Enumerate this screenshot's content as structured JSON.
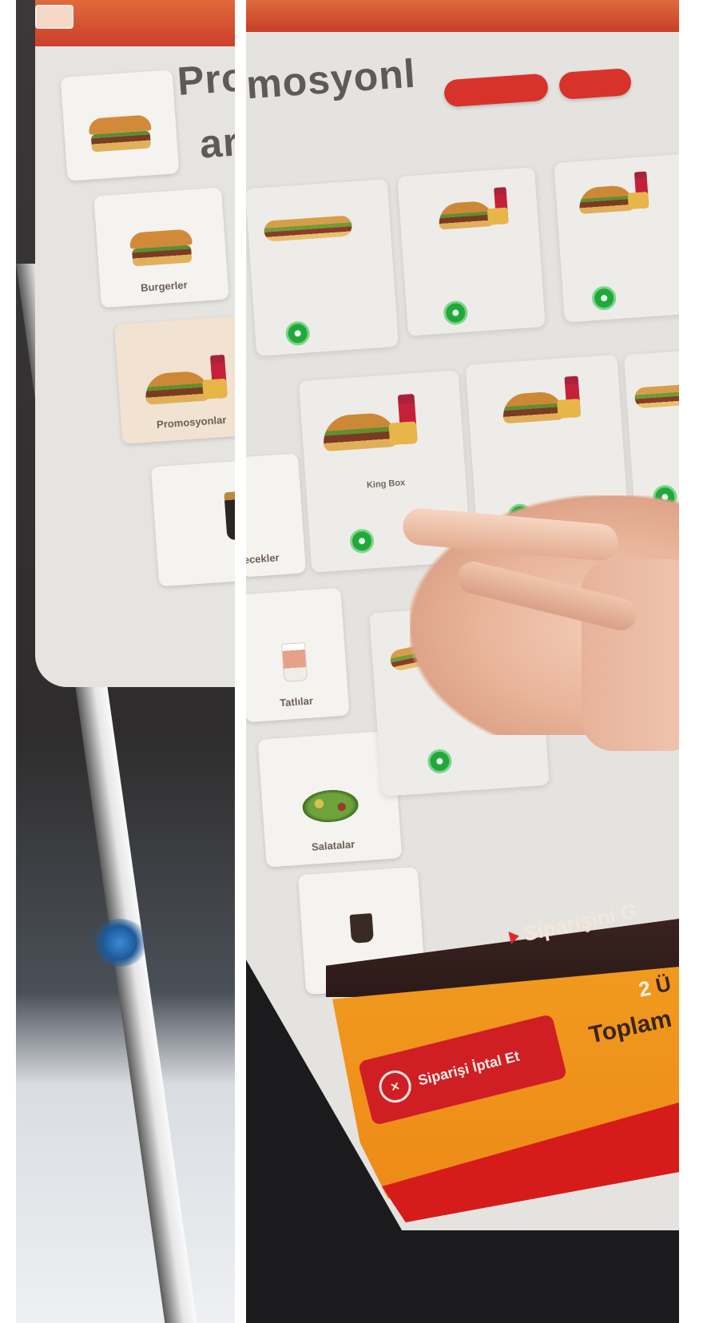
{
  "header": {
    "title_part1": "Pro",
    "title_part2": "mosyonl",
    "title_line2": "ar",
    "pill_left": "",
    "pill_right": ""
  },
  "sidebar": {
    "items": [
      {
        "label": "",
        "icon": "burger-icon"
      },
      {
        "label": "Burgerler",
        "icon": "burger-icon"
      },
      {
        "label": "Promosyonlar",
        "icon": "combo-meal-icon",
        "active": true
      },
      {
        "label": "İçecekler",
        "icon": "drink-icon"
      },
      {
        "label": "Tatlılar",
        "icon": "dessert-cup-icon"
      },
      {
        "label": "Salatalar",
        "icon": "salad-icon"
      },
      {
        "label": "",
        "icon": "coffee-icon"
      }
    ]
  },
  "products": [
    {
      "name": "",
      "price": "",
      "icon": "sub-sandwich-icon"
    },
    {
      "name": "",
      "price": "",
      "icon": "combo-meal-icon"
    },
    {
      "name": "",
      "price": "",
      "icon": "sandwich-icon"
    },
    {
      "name": "King Box",
      "price": "",
      "icon": "combo-meal-icon"
    },
    {
      "name": "",
      "price": "",
      "icon": "sandwich-combo-icon"
    },
    {
      "name": "",
      "price": "",
      "icon": "sandwich-icon"
    },
    {
      "name": "",
      "price": "",
      "icon": "sub-sandwich-icon"
    }
  ],
  "order": {
    "title": "Siparişini G",
    "quantity": "2",
    "quantity_suffix": "Ü",
    "total_label": "Toplam",
    "cancel_label": "Siparişi İptal Et"
  },
  "colors": {
    "accent_red": "#d8332b",
    "add_green": "#20a93a",
    "panel_orange": "#f09a1e",
    "screen_bg": "#e5e3df"
  }
}
